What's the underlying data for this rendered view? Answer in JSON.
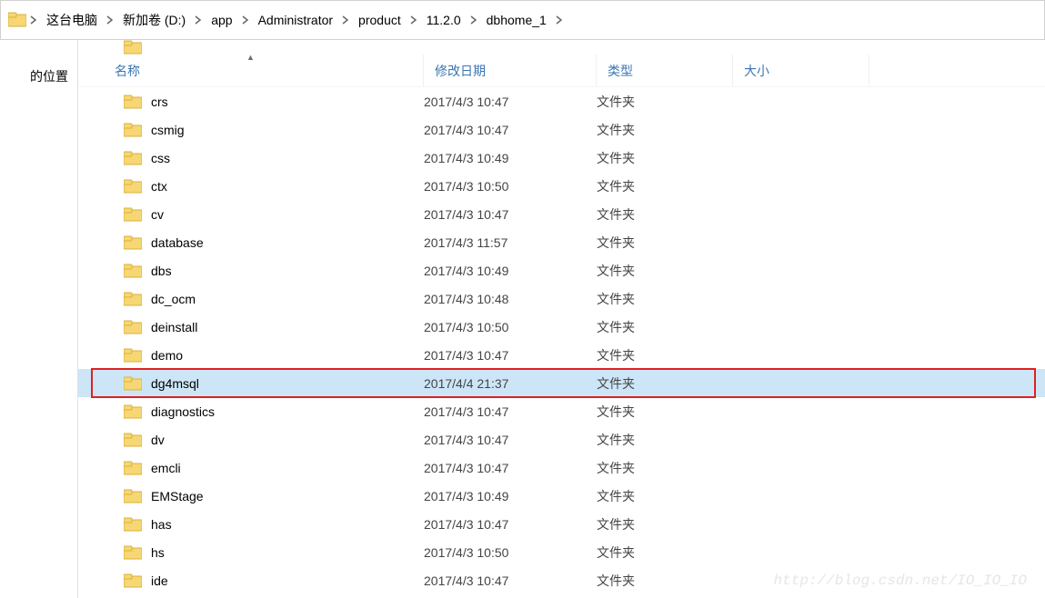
{
  "breadcrumb": [
    "这台电脑",
    "新加卷 (D:)",
    "app",
    "Administrator",
    "product",
    "11.2.0",
    "dbhome_1"
  ],
  "sidebar": {
    "location_label": "的位置"
  },
  "headers": {
    "name": "名称",
    "date": "修改日期",
    "type": "类型",
    "size": "大小"
  },
  "type_folder": "文件夹",
  "files": [
    {
      "name": "crs",
      "date": "2017/4/3 10:47",
      "type": "文件夹",
      "selected": false,
      "hl": false
    },
    {
      "name": "csmig",
      "date": "2017/4/3 10:47",
      "type": "文件夹",
      "selected": false,
      "hl": false
    },
    {
      "name": "css",
      "date": "2017/4/3 10:49",
      "type": "文件夹",
      "selected": false,
      "hl": false
    },
    {
      "name": "ctx",
      "date": "2017/4/3 10:50",
      "type": "文件夹",
      "selected": false,
      "hl": false
    },
    {
      "name": "cv",
      "date": "2017/4/3 10:47",
      "type": "文件夹",
      "selected": false,
      "hl": false
    },
    {
      "name": "database",
      "date": "2017/4/3 11:57",
      "type": "文件夹",
      "selected": false,
      "hl": false
    },
    {
      "name": "dbs",
      "date": "2017/4/3 10:49",
      "type": "文件夹",
      "selected": false,
      "hl": false
    },
    {
      "name": "dc_ocm",
      "date": "2017/4/3 10:48",
      "type": "文件夹",
      "selected": false,
      "hl": false
    },
    {
      "name": "deinstall",
      "date": "2017/4/3 10:50",
      "type": "文件夹",
      "selected": false,
      "hl": false
    },
    {
      "name": "demo",
      "date": "2017/4/3 10:47",
      "type": "文件夹",
      "selected": false,
      "hl": false
    },
    {
      "name": "dg4msql",
      "date": "2017/4/4 21:37",
      "type": "文件夹",
      "selected": true,
      "hl": true
    },
    {
      "name": "diagnostics",
      "date": "2017/4/3 10:47",
      "type": "文件夹",
      "selected": false,
      "hl": false
    },
    {
      "name": "dv",
      "date": "2017/4/3 10:47",
      "type": "文件夹",
      "selected": false,
      "hl": false
    },
    {
      "name": "emcli",
      "date": "2017/4/3 10:47",
      "type": "文件夹",
      "selected": false,
      "hl": false
    },
    {
      "name": "EMStage",
      "date": "2017/4/3 10:49",
      "type": "文件夹",
      "selected": false,
      "hl": false
    },
    {
      "name": "has",
      "date": "2017/4/3 10:47",
      "type": "文件夹",
      "selected": false,
      "hl": false
    },
    {
      "name": "hs",
      "date": "2017/4/3 10:50",
      "type": "文件夹",
      "selected": false,
      "hl": false
    },
    {
      "name": "ide",
      "date": "2017/4/3 10:47",
      "type": "文件夹",
      "selected": false,
      "hl": false
    }
  ],
  "watermark": "http://blog.csdn.net/IO_IO_IO"
}
